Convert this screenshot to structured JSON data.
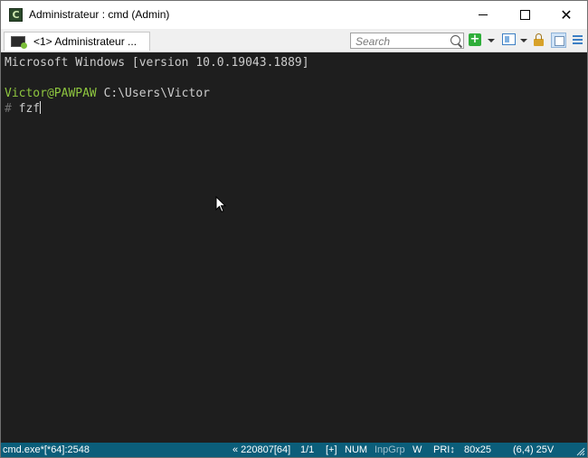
{
  "window": {
    "title": "Administrateur : cmd (Admin)",
    "app_icon_glyph": "C",
    "controls": {
      "minimize": "minimize-icon",
      "maximize": "maximize-icon",
      "close": "✕"
    }
  },
  "toolbar": {
    "tab_label": "<1> Administrateur ...",
    "search_placeholder": "Search",
    "new_console_glyph": "+",
    "icons": [
      "search-icon",
      "new-console-icon",
      "split-icon",
      "lock-icon",
      "panel-icon",
      "menu-icon"
    ]
  },
  "terminal": {
    "banner": "Microsoft Windows [version 10.0.19043.1889]",
    "user_host": "Victor@PAWPAW",
    "cwd": "C:\\Users\\Victor",
    "prompt_symbol": "#",
    "input": "fzf",
    "colors": {
      "background": "#1e1e1e",
      "user_host": "#8ec63f",
      "text": "#cccccc"
    }
  },
  "statusbar": {
    "process": "cmd.exe*[*64]:2548",
    "buffer": "« 220807[64]",
    "console_index": "1/1",
    "plus": "[+]",
    "num": "NUM",
    "inpgrp": "InpGrp",
    "w": "W",
    "pri": "PRI↕",
    "size": "80x25",
    "cursor_pos": "(6,4) 25V",
    "background_color": "#0b5e7a"
  }
}
